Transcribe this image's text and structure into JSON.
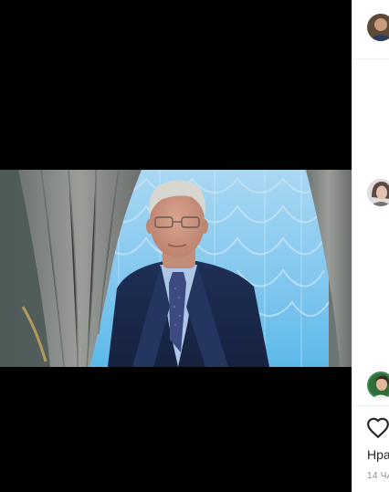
{
  "post": {
    "media_type": "video",
    "likes_label": "Нра",
    "time_label": "14 ЧА"
  },
  "icons": {
    "like": "heart-outline-icon"
  },
  "colors": {
    "background_dark": "#000000",
    "panel_bg": "#ffffff",
    "divider": "#efefef",
    "text_primary": "#262626",
    "text_secondary": "#8e8e8e"
  }
}
